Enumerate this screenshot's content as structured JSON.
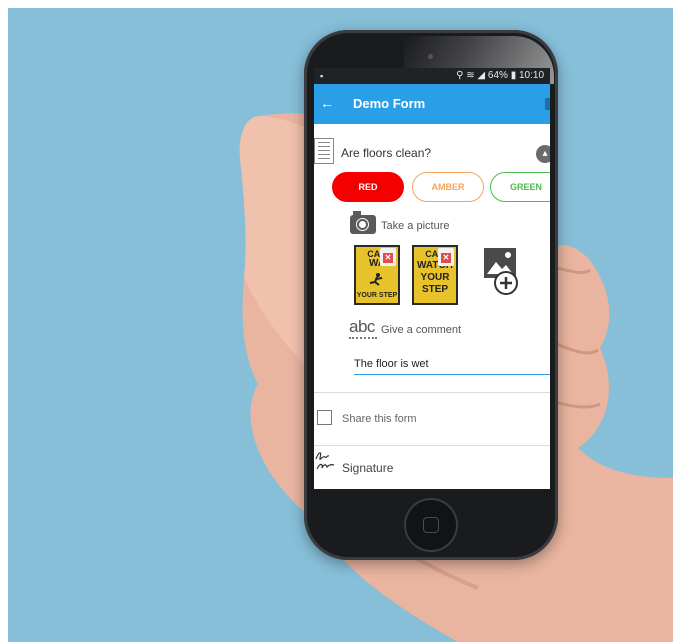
{
  "status_bar": {
    "left_indicator": "▪",
    "right": "⚲ ≋ ◢ 64% ▮ 10:10"
  },
  "app_bar": {
    "back_icon": "←",
    "title": "Demo Form",
    "color": "#2a9fe8"
  },
  "question": {
    "text": "Are floors clean?",
    "collapse_icon": "ⴷ",
    "options": [
      {
        "label": "RED",
        "color": "#f50000",
        "selected": true
      },
      {
        "label": "AMBER",
        "color": "#f4a65a",
        "selected": false
      },
      {
        "label": "GREEN",
        "color": "#4cbb4c",
        "selected": false
      }
    ]
  },
  "photo": {
    "label": "Take a picture",
    "thumbnails": [
      {
        "sign_line1": "CAU",
        "sign_line2": "WA",
        "sign_line3": "YOUR STEP",
        "delete_icon": "✕"
      },
      {
        "sign_line1": "CAU",
        "sign_line2": "WATCH",
        "sign_line3": "YOUR",
        "sign_line4": "STEP",
        "delete_icon": "✕"
      }
    ]
  },
  "comment": {
    "icon_text": "abc",
    "label": "Give a comment",
    "value": "The floor is wet"
  },
  "share": {
    "label": "Share this form",
    "checked": false
  },
  "signature": {
    "label": "Signature"
  }
}
